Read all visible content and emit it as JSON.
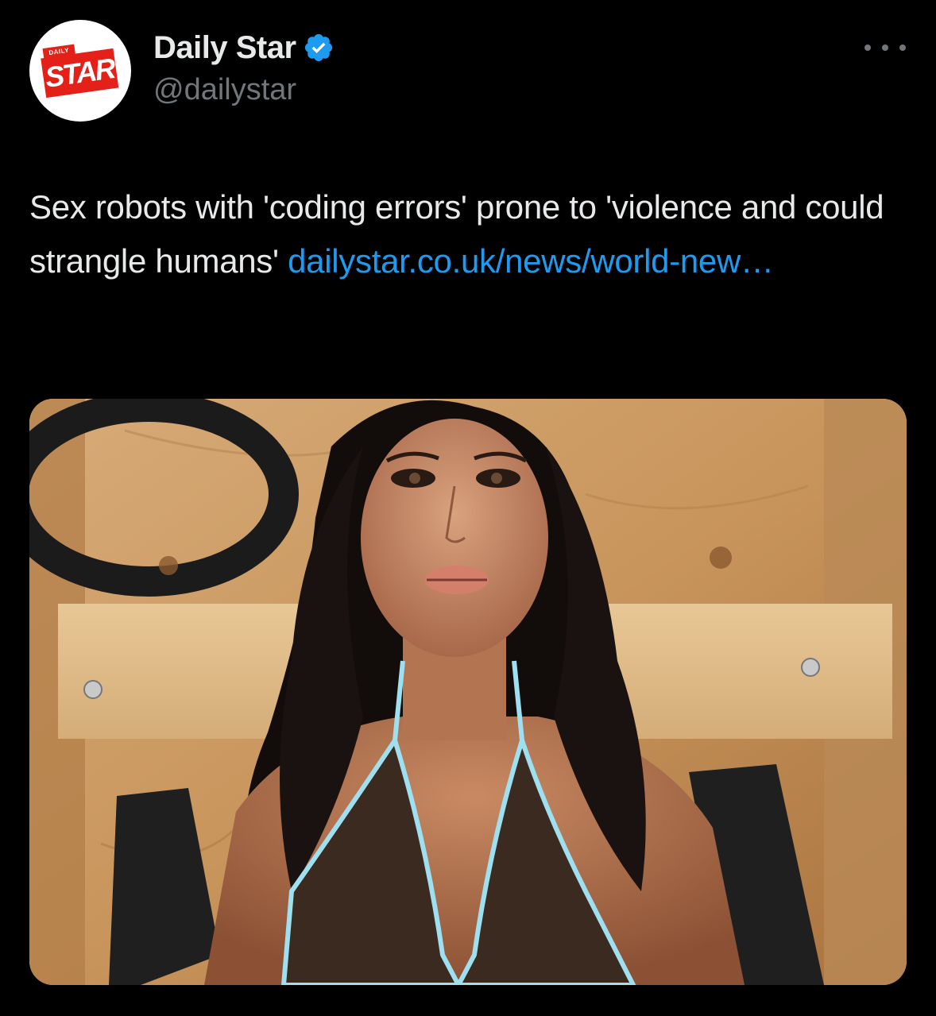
{
  "author": {
    "display_name": "Daily Star",
    "handle": "@dailystar",
    "verified": true,
    "avatar_logo": {
      "small_text": "DAILY",
      "main_text": "STAR",
      "brand_color": "#e32119"
    }
  },
  "menu": {
    "icon": "more-horizontal-icon"
  },
  "tweet": {
    "text_before_link": "Sex robots with 'coding errors' prone to 'violence and could strangle humans' ",
    "link_text": "dailystar.co.uk/news/world-new…"
  },
  "colors": {
    "background": "#000000",
    "text": "#e7e9ea",
    "secondary": "#71767b",
    "link": "#1d9bf0",
    "verified": "#1d9bf0"
  },
  "media": {
    "icon": "photo-icon"
  }
}
